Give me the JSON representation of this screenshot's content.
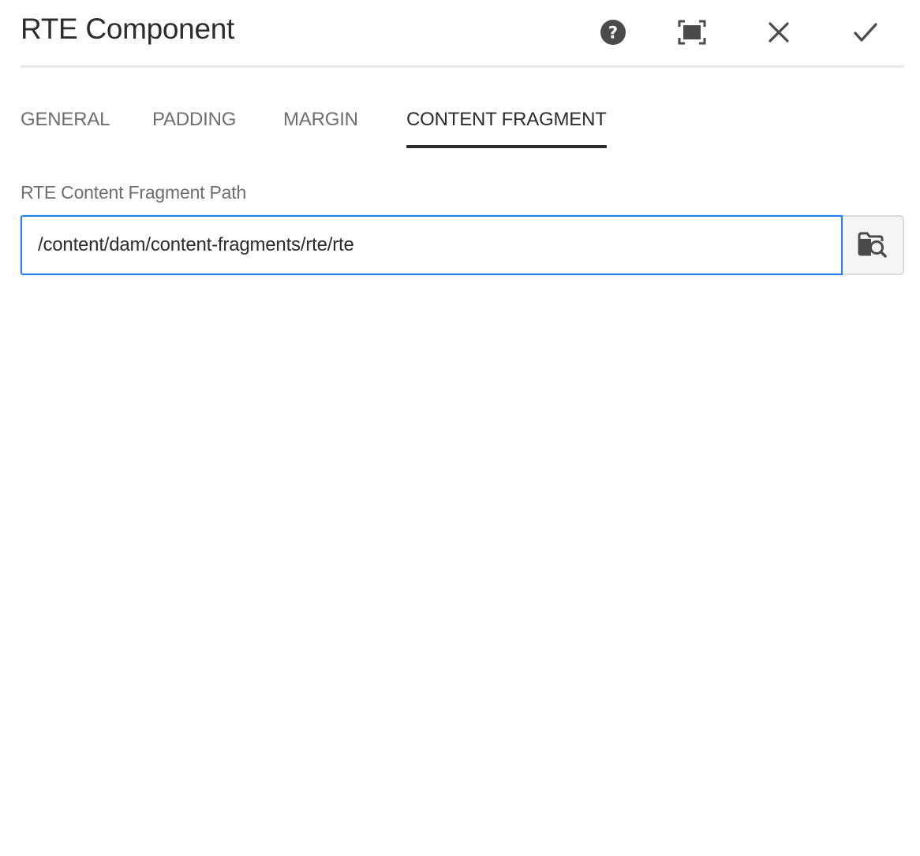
{
  "dialog": {
    "title": "RTE Component",
    "actions": [
      {
        "name": "help",
        "icon": "help-icon"
      },
      {
        "name": "fullscreen",
        "icon": "fullscreen-icon"
      },
      {
        "name": "close",
        "icon": "close-icon"
      },
      {
        "name": "done",
        "icon": "checkmark-icon"
      }
    ]
  },
  "tabs": [
    {
      "label": "GENERAL",
      "active": false
    },
    {
      "label": "PADDING",
      "active": false
    },
    {
      "label": "MARGIN",
      "active": false
    },
    {
      "label": "CONTENT FRAGMENT",
      "active": true
    }
  ],
  "field": {
    "label": "RTE Content Fragment Path",
    "value": "/content/dam/content-fragments/rte/rte",
    "browse_icon": "folder-search-icon"
  },
  "colors": {
    "focus_border": "#2680eb",
    "text_primary": "#2c2c2c",
    "text_secondary": "#6e6e6e",
    "divider": "#eaeaea"
  }
}
